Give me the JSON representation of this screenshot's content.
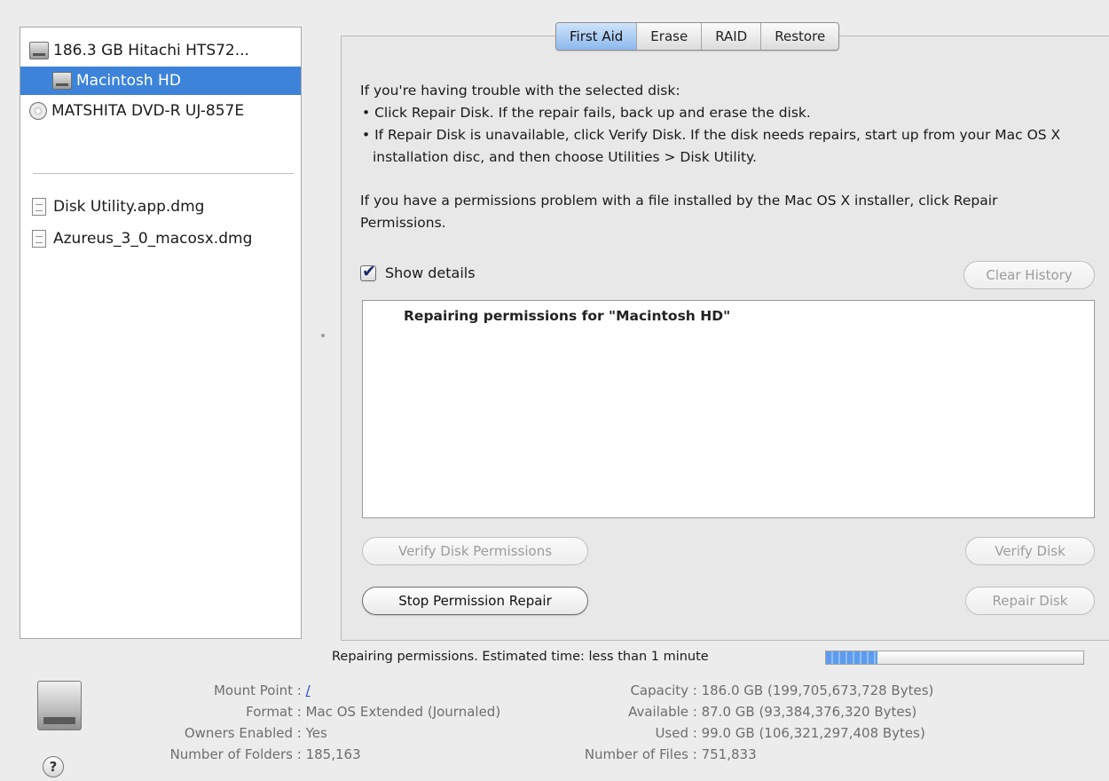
{
  "sidebar": {
    "items": [
      {
        "label": "186.3 GB Hitachi HTS72...",
        "icon": "hard-drive-icon"
      },
      {
        "label": "Macintosh HD",
        "icon": "volume-icon"
      },
      {
        "label": "MATSHITA DVD-R UJ-857E",
        "icon": "dvd-drive-icon"
      },
      {
        "label": "Disk Utility.app.dmg",
        "icon": "disk-image-icon"
      },
      {
        "label": "Azureus_3_0_macosx.dmg",
        "icon": "disk-image-icon"
      }
    ],
    "selected": "Macintosh HD"
  },
  "tabs": [
    {
      "label": "First Aid",
      "active": true
    },
    {
      "label": "Erase",
      "active": false
    },
    {
      "label": "RAID",
      "active": false
    },
    {
      "label": "Restore",
      "active": false
    }
  ],
  "first_aid": {
    "intro": "If you're having trouble with the selected disk:",
    "bullet1": "• Click Repair Disk. If the repair fails, back up and erase the disk.",
    "bullet2": "• If Repair Disk is unavailable, click Verify Disk. If the disk needs repairs, start up from your Mac OS X installation disc, and then choose Utilities > Disk Utility.",
    "permissions_note": "If you have a permissions problem with a file installed by the Mac OS X installer, click Repair Permissions.",
    "show_details_label": "Show details",
    "show_details_checked": true,
    "clear_history_label": "Clear History",
    "log_line": "Repairing permissions for \"Macintosh HD\"",
    "verify_permissions_label": "Verify Disk Permissions",
    "stop_repair_label": "Stop Permission Repair",
    "verify_disk_label": "Verify Disk",
    "repair_disk_label": "Repair Disk"
  },
  "status": {
    "text": "Repairing permissions. Estimated time: less than 1 minute",
    "progress": 0.2
  },
  "disk_info": {
    "mount_point_label": "Mount Point",
    "mount_point": "/",
    "format_label": "Format",
    "format": "Mac OS Extended (Journaled)",
    "owners_label": "Owners Enabled",
    "owners": "Yes",
    "folders_label": "Number of Folders",
    "folders": "185,163",
    "capacity_label": "Capacity",
    "capacity": "186.0 GB (199,705,673,728 Bytes)",
    "available_label": "Available",
    "available": "87.0 GB (93,384,376,320 Bytes)",
    "used_label": "Used",
    "used": "99.0 GB (106,321,297,408 Bytes)",
    "files_label": "Number of Files",
    "files": "751,833"
  },
  "help_symbol": "?",
  "colors": {
    "selection": "#3d83d9",
    "tab_active": "#8db9ee",
    "progress_fill": "#5d9cec",
    "link": "#2250c8"
  }
}
